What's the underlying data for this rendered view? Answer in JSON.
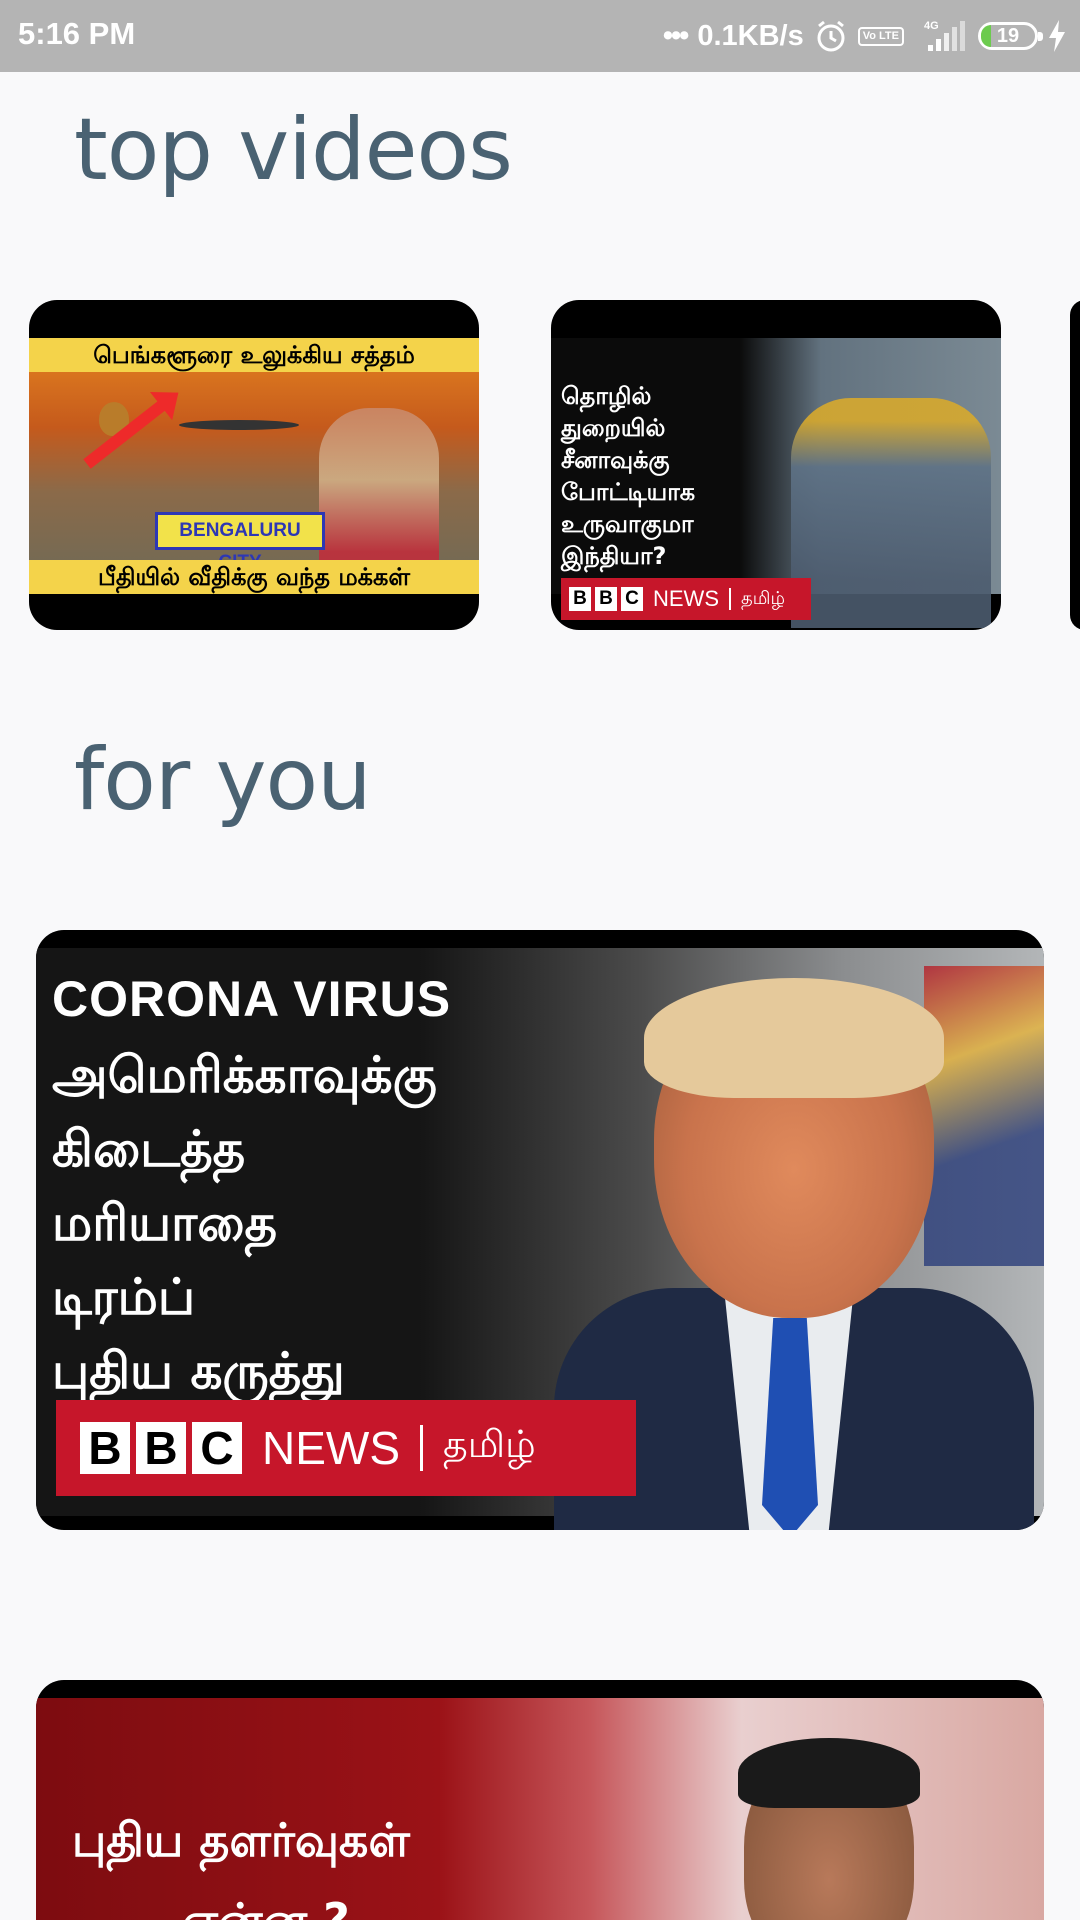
{
  "status_bar": {
    "time": "5:16 PM",
    "dots": "•••",
    "net_speed": "0.1KB/s",
    "volte_label": "Vo LTE",
    "network_type": "4G",
    "battery_level": "19",
    "icons": [
      "alarm-icon",
      "volte-icon",
      "signal-icon",
      "battery-icon",
      "charging-icon"
    ]
  },
  "sections": {
    "top_videos_title": "top videos",
    "for_you_title": "for you"
  },
  "top_videos": [
    {
      "banner_top": "பெங்களூரை உலுக்கிய சத்தம்",
      "city_label": "BENGALURU CITY",
      "banner_bottom": "பீதியில் வீதிக்கு வந்த மக்கள்"
    },
    {
      "lines": [
        "தொழில்",
        "துறையில்",
        "சீனாவுக்கு",
        "போட்டியாக",
        "உருவாகுமா",
        "இந்தியா?"
      ],
      "brand": {
        "b1": "B",
        "b2": "B",
        "b3": "C",
        "news": "NEWS",
        "lang": "தமிழ்"
      }
    }
  ],
  "for_you": [
    {
      "headline": "CORONA VIRUS",
      "lines": [
        "அமெரிக்காவுக்கு",
        "கிடைத்த",
        "மரியாதை",
        "டிரம்ப்",
        "புதிய கருத்து"
      ],
      "brand": {
        "b1": "B",
        "b2": "B",
        "b3": "C",
        "news": "NEWS",
        "lang": "தமிழ்"
      }
    },
    {
      "lines": [
        "புதிய தளர்வுகள்",
        "என்ன ?"
      ]
    }
  ],
  "colors": {
    "background": "#f9f9fa",
    "status_bar": "#b4b4b4",
    "heading": "#4a6272",
    "bbc_red": "#c6162a",
    "banner_yellow": "#f4d34a"
  }
}
